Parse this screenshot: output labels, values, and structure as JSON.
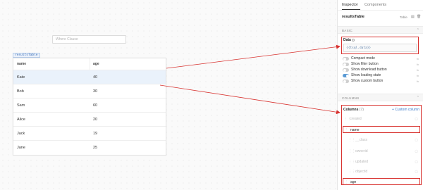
{
  "canvas": {
    "where_placeholder": "Where Clause",
    "component_tag": "resultsTable",
    "table": {
      "columns": [
        "name",
        "age"
      ],
      "rows": [
        {
          "name": "Kate",
          "age": "40"
        },
        {
          "name": "Bob",
          "age": "30"
        },
        {
          "name": "Sam",
          "age": "60"
        },
        {
          "name": "Alice",
          "age": "20"
        },
        {
          "name": "Jack",
          "age": "19"
        },
        {
          "name": "Jane",
          "age": "25"
        }
      ],
      "selected_row": 0
    }
  },
  "inspector": {
    "tabs": [
      "Inspector",
      "Components"
    ],
    "active_tab": "Inspector",
    "component_name": "resultsTable",
    "component_type": "Table",
    "basic": {
      "section_label": "BASIC",
      "data_label": "Data",
      "data_value": "{{tsql.data}}",
      "toggles": [
        {
          "label": "Compact mode",
          "on": false
        },
        {
          "label": "Show filter button",
          "on": false
        },
        {
          "label": "Show download button",
          "on": false
        },
        {
          "label": "Show loading state",
          "on": true
        },
        {
          "label": "Show custom button",
          "on": false
        }
      ],
      "fx_label": "fx"
    },
    "columns": {
      "section_label": "COLUMNS",
      "title": "Columns",
      "count": "(7)",
      "add_label": "+ Custom column",
      "items": [
        {
          "label": "created",
          "active": false,
          "nested": false
        },
        {
          "label": "name",
          "active": true,
          "nested": false
        },
        {
          "label": "__class",
          "active": false,
          "nested": true
        },
        {
          "label": "ownerid",
          "active": false,
          "nested": true
        },
        {
          "label": "updated",
          "active": false,
          "nested": true
        },
        {
          "label": "objectid",
          "active": false,
          "nested": true
        },
        {
          "label": "age",
          "active": true,
          "nested": false
        }
      ]
    }
  },
  "colors": {
    "annotation_red": "#d8322f",
    "accent_blue": "#3a78c8",
    "selected_row_bg": "#eaf2fb"
  }
}
